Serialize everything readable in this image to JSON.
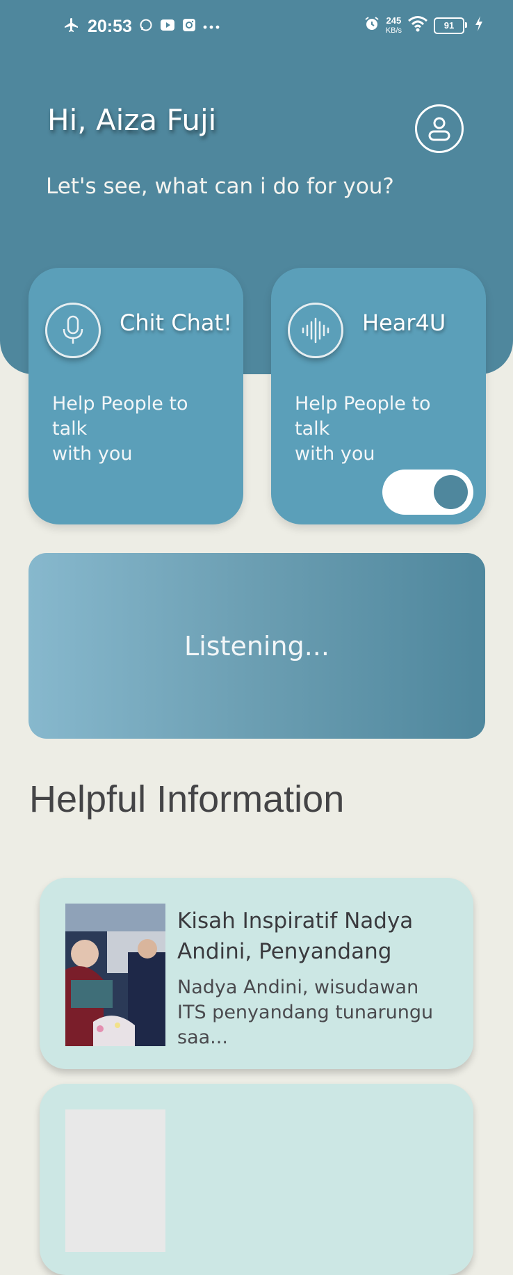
{
  "status_bar": {
    "time": "20:53",
    "net_speed_value": "245",
    "net_speed_unit": "KB/s",
    "battery": "91",
    "icons": [
      "airplane-icon",
      "whatsapp-icon",
      "youtube-icon",
      "instagram-icon",
      "more-dots-icon",
      "alarm-icon",
      "wifi-icon",
      "battery-icon",
      "charging-icon"
    ]
  },
  "header": {
    "greeting": "Hi, Aiza Fuji",
    "subtitle": "Let's see, what can i do for you?",
    "profile_icon": "user-icon"
  },
  "features": [
    {
      "title": "Chit Chat!",
      "description": "Help People to talk\nwith you",
      "icon": "microphone-icon"
    },
    {
      "title": "Hear4U",
      "description": "Help People to talk\nwith you",
      "icon": "sound-wave-icon",
      "toggle_on": true
    }
  ],
  "listening": {
    "text": "Listening..."
  },
  "helpful_info": {
    "title": "Helpful Information",
    "articles": [
      {
        "title": "Kisah Inspiratif Nadya Andini, Penyandang",
        "summary": "Nadya Andini, wisudawan ITS penyandang tunarungu saa..."
      }
    ]
  },
  "colors": {
    "header": "#4F879D",
    "card": "#5B9FB9",
    "background": "#EDEDE5",
    "info_card": "#CCE7E4"
  }
}
